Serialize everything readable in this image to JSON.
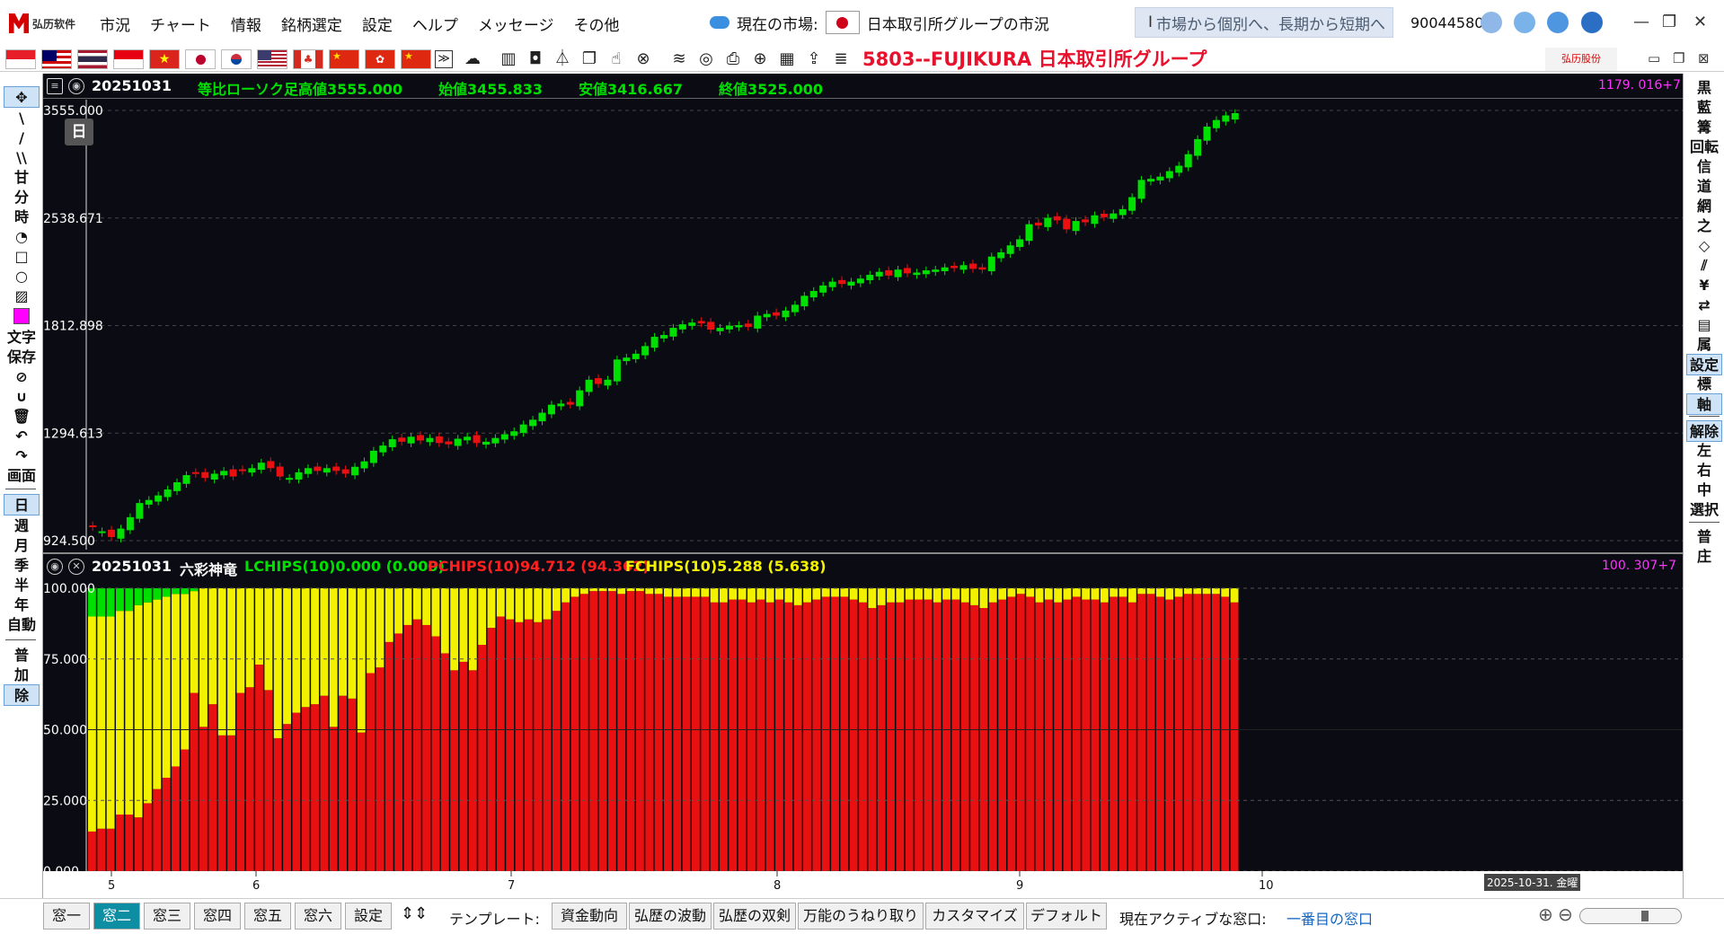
{
  "app": {
    "logo_text": "弘历软件",
    "menu": [
      "市況",
      "チャート",
      "情報",
      "銘柄選定",
      "設定",
      "ヘルプ",
      "メッセージ",
      "その他"
    ],
    "market_label": "現在の市場:",
    "market_name": "日本取引所グループの市況",
    "search_placeholder": "市場から個別へ、長期から短期へ",
    "user_id": "90044580"
  },
  "toolbar": {
    "flags": [
      "sg",
      "my",
      "th",
      "id",
      "vn",
      "jp",
      "kr",
      "us",
      "ca",
      "cn",
      "hk",
      "cn2"
    ],
    "stock_title": "5803--FUJIKURA  日本取引所グループ",
    "brand_mini": "弘历股份"
  },
  "left_tools": {
    "draw": [
      "\\",
      "/",
      "\\\\",
      "甘",
      "分",
      "時"
    ],
    "text_label": "文字",
    "save_label": "保存",
    "screen_label": "画面",
    "periods": [
      "日",
      "週",
      "月",
      "季",
      "半",
      "年",
      "自動"
    ],
    "add_labels": [
      "普",
      "加",
      "除"
    ]
  },
  "right_tools": [
    "黒",
    "藍",
    "篝",
    "回転",
    "信",
    "道",
    "網",
    "之",
    "属",
    "設定",
    "標",
    "軸",
    "解除",
    "左",
    "右",
    "中",
    "選択",
    "普",
    "庄"
  ],
  "main_chart": {
    "header": {
      "date": "20251031",
      "name": "等比ローソク足",
      "high": "高値3555.000",
      "open": "始値3455.833",
      "low": "安値3416.667",
      "close": "終値3525.000",
      "right_value": "1179. 016+7"
    },
    "period_badge": "日",
    "y_labels": [
      "3555.000",
      "2538.671",
      "1812.898",
      "1294.613",
      "924.500"
    ]
  },
  "sub_chart": {
    "header": {
      "date": "20251031",
      "name": "六彩神竜",
      "lchips": "LCHIPS(10)0.000 (0.000)",
      "pchips": "PCHIPS(10)94.712 (94.362)",
      "fchips": "FCHIPS(10)5.288 (5.638)",
      "right_value": "100. 307+7"
    },
    "y_labels": [
      "100.000",
      "75.000",
      "50.000",
      "25.000",
      "0.000"
    ]
  },
  "time_axis": {
    "month_labels": [
      "5",
      "6",
      "7",
      "8",
      "9",
      "10"
    ],
    "cursor_date": "2025-10-31. 金曜"
  },
  "bottom": {
    "windows": [
      "窓一",
      "窓二",
      "窓三",
      "窓四",
      "窓五",
      "窓六",
      "設定"
    ],
    "active_window": "窓二",
    "template_label": "テンプレート:",
    "templates": [
      "資金動向",
      "弘歴の波動",
      "弘歴の双剣",
      "万能のうねり取り",
      "カスタマイズ",
      "デフォルト"
    ],
    "active_label": "現在アクティブな窓口:",
    "active_value": "一番目の窓口"
  },
  "colors": {
    "up": "#00e000",
    "down": "#e81010",
    "yellow": "#f2f200",
    "header_green": "#00e000",
    "accent": "#0e8ea3",
    "magenta": "#ff33ff"
  },
  "chart_data": [
    {
      "type": "candlestick",
      "title": "等比ローソク足",
      "scale": "log",
      "ylim": [
        924.5,
        3555.0
      ],
      "y_ticks": [
        3555.0,
        2538.671,
        1812.898,
        1294.613,
        924.5
      ],
      "x_month_ticks": [
        "5",
        "6",
        "7",
        "8",
        "9",
        "10"
      ],
      "last_bar": {
        "date": "20251031",
        "open": 3455.833,
        "high": 3555.0,
        "low": 3416.667,
        "close": 3525.0
      },
      "closes": [
        965,
        952,
        935,
        960,
        995,
        1040,
        1050,
        1065,
        1085,
        1110,
        1135,
        1140,
        1125,
        1140,
        1150,
        1130,
        1150,
        1160,
        1180,
        1160,
        1130,
        1125,
        1145,
        1160,
        1150,
        1160,
        1150,
        1140,
        1165,
        1185,
        1225,
        1245,
        1270,
        1260,
        1280,
        1265,
        1275,
        1255,
        1250,
        1272,
        1280,
        1255,
        1260,
        1275,
        1290,
        1302,
        1330,
        1350,
        1380,
        1415,
        1420,
        1415,
        1480,
        1530,
        1510,
        1530,
        1630,
        1640,
        1660,
        1700,
        1750,
        1760,
        1800,
        1820,
        1830,
        1825,
        1790,
        1800,
        1812,
        1815,
        1805,
        1870,
        1880,
        1870,
        1900,
        1935,
        1990,
        2020,
        2055,
        2080,
        2065,
        2080,
        2100,
        2125,
        2145,
        2120,
        2160,
        2135,
        2140,
        2155,
        2160,
        2175,
        2170,
        2190,
        2165,
        2160,
        2250,
        2280,
        2330,
        2375,
        2490,
        2480,
        2540,
        2520,
        2450,
        2515,
        2505,
        2560,
        2545,
        2575,
        2610,
        2710,
        2860,
        2870,
        2890,
        2940,
        2990,
        3100,
        3250,
        3380,
        3450,
        3500,
        3525
      ],
      "up_flags": [
        0,
        1,
        0,
        1,
        1,
        1,
        1,
        1,
        1,
        1,
        1,
        0,
        0,
        1,
        1,
        0,
        0,
        1,
        1,
        0,
        0,
        1,
        1,
        1,
        0,
        1,
        0,
        0,
        1,
        1,
        1,
        1,
        1,
        0,
        1,
        0,
        1,
        0,
        0,
        1,
        1,
        0,
        1,
        1,
        1,
        1,
        1,
        1,
        1,
        1,
        1,
        0,
        1,
        1,
        0,
        1,
        1,
        1,
        1,
        1,
        1,
        1,
        1,
        1,
        1,
        0,
        0,
        1,
        1,
        1,
        0,
        1,
        1,
        0,
        1,
        1,
        1,
        1,
        1,
        1,
        0,
        1,
        1,
        1,
        1,
        0,
        1,
        0,
        1,
        1,
        1,
        1,
        0,
        1,
        0,
        0,
        1,
        1,
        1,
        1,
        1,
        0,
        1,
        0,
        0,
        1,
        0,
        1,
        0,
        1,
        1,
        1,
        1,
        1,
        1,
        1,
        1,
        1,
        1,
        1,
        1,
        1,
        1
      ]
    },
    {
      "type": "bar",
      "stacked": true,
      "title": "六彩神竜",
      "ylim": [
        0,
        100
      ],
      "y_ticks": [
        100,
        75,
        50,
        25,
        0
      ],
      "series": [
        {
          "name": "LCHIPS(10)",
          "values": [
            10,
            10,
            10,
            8,
            8,
            6,
            5,
            4,
            3,
            2,
            2,
            1,
            0,
            0,
            0,
            0,
            0,
            0,
            0,
            0,
            0,
            0,
            0,
            0,
            0,
            0,
            0,
            0,
            0,
            0,
            0,
            0,
            0,
            0,
            0,
            0,
            0,
            0,
            0,
            0,
            0,
            0,
            0,
            0,
            0,
            0,
            0,
            0,
            0,
            0,
            0,
            0,
            0,
            0,
            0,
            0,
            0,
            0,
            0,
            0,
            0,
            0,
            0,
            0,
            0,
            0,
            0,
            0,
            0,
            0,
            0,
            0,
            0,
            0,
            0,
            0,
            0,
            0,
            0,
            0,
            0,
            0,
            0,
            0,
            0,
            0,
            0,
            0,
            0,
            0,
            0,
            0,
            0,
            0,
            0,
            0,
            0,
            0,
            0,
            0,
            0,
            0,
            0,
            0,
            0,
            0,
            0,
            0,
            0,
            0,
            0,
            0,
            0,
            0,
            0,
            0,
            0,
            0,
            0,
            0,
            0,
            0,
            0,
            0
          ]
        },
        {
          "name": "PCHIPS(10)",
          "values": [
            14,
            15,
            15,
            20,
            20,
            19,
            24,
            29,
            33,
            37,
            43,
            63,
            51,
            59,
            48,
            48,
            63,
            65,
            73,
            64,
            47,
            52,
            56,
            58,
            59,
            62,
            51,
            62,
            61,
            49,
            70,
            72,
            81,
            84,
            87,
            89,
            87,
            83,
            77,
            71,
            74,
            71,
            80,
            86,
            90,
            89,
            88,
            89,
            88,
            89,
            92,
            95,
            97,
            98,
            99,
            99,
            99,
            98,
            99,
            99,
            98,
            98,
            97,
            97,
            97,
            97,
            97,
            95,
            95,
            96,
            96,
            95,
            96,
            95,
            96,
            95,
            94,
            95,
            96,
            97,
            97,
            97,
            96,
            95,
            93,
            94,
            95,
            95,
            96,
            96,
            96,
            95,
            96,
            96,
            95,
            94,
            93,
            95,
            96,
            97,
            98,
            97,
            95,
            96,
            95,
            96,
            97,
            96,
            96,
            95,
            97,
            97,
            95,
            98,
            98,
            97,
            96,
            97,
            98,
            98,
            98,
            98,
            97,
            95
          ]
        },
        {
          "name": "FCHIPS(10)",
          "values": [
            76,
            75,
            75,
            72,
            72,
            75,
            71,
            67,
            64,
            61,
            55,
            36,
            49,
            41,
            52,
            52,
            37,
            35,
            27,
            36,
            53,
            48,
            44,
            42,
            41,
            38,
            49,
            38,
            39,
            51,
            30,
            28,
            19,
            16,
            13,
            11,
            13,
            17,
            23,
            29,
            26,
            29,
            20,
            14,
            10,
            11,
            12,
            11,
            12,
            11,
            8,
            5,
            3,
            2,
            1,
            1,
            1,
            2,
            1,
            1,
            2,
            2,
            3,
            3,
            3,
            3,
            3,
            5,
            5,
            4,
            4,
            5,
            4,
            5,
            4,
            5,
            6,
            5,
            4,
            3,
            3,
            3,
            4,
            5,
            7,
            6,
            5,
            5,
            4,
            4,
            4,
            5,
            4,
            4,
            5,
            6,
            7,
            5,
            4,
            3,
            2,
            3,
            5,
            4,
            5,
            4,
            3,
            4,
            4,
            5,
            3,
            3,
            5,
            2,
            2,
            3,
            4,
            3,
            2,
            2,
            2,
            2,
            3,
            5
          ]
        }
      ],
      "last_values": {
        "LCHIPS": 0.0,
        "PCHIPS": 94.712,
        "FCHIPS": 5.288
      }
    }
  ]
}
